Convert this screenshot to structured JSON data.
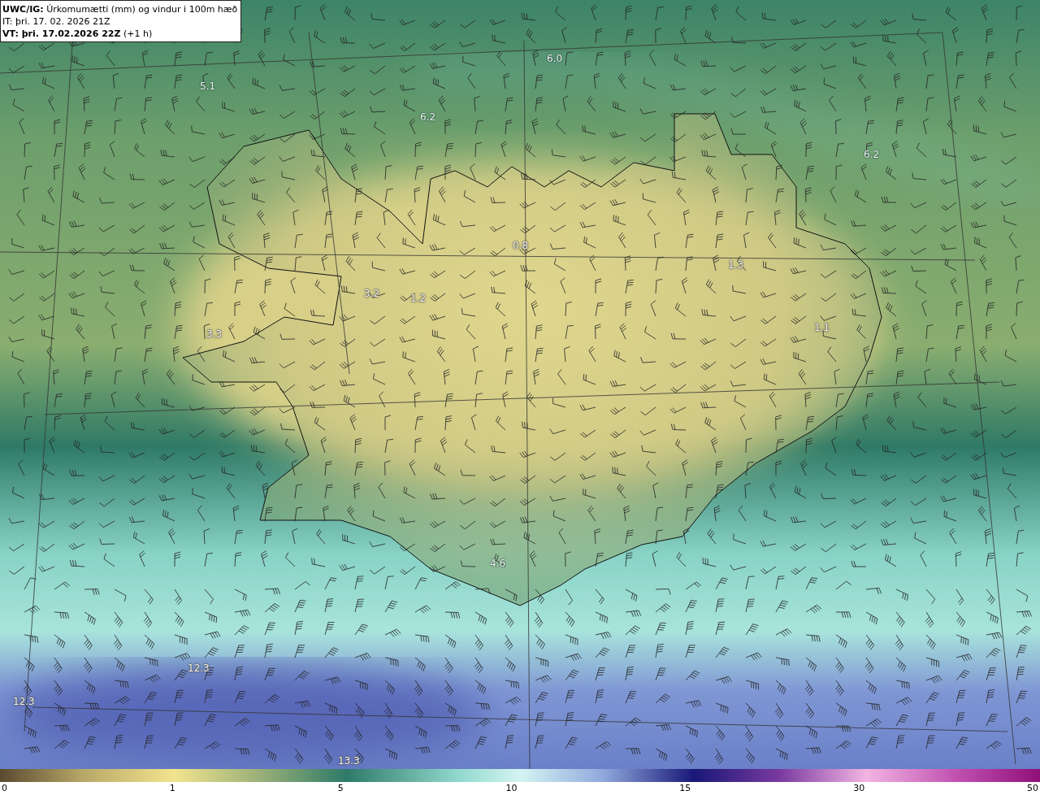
{
  "legend_box": {
    "title": "**UWC/IG:** Úrkomumætti (mm) og vindur i 100m hæð",
    "issue_time": "IT: þri. 17. 02. 2026 21Z",
    "valid_time": "**VT: þri. 17.02.2026 22Z** (+1 h)"
  },
  "map_labels": [
    {
      "text": "5.1",
      "kind": "normal"
    },
    {
      "text": "6.0",
      "kind": "normal"
    },
    {
      "text": "6.2",
      "kind": "normal"
    },
    {
      "text": "6.2",
      "kind": "normal"
    },
    {
      "text": "0.8",
      "kind": "faint"
    },
    {
      "text": "1.3",
      "kind": "faint"
    },
    {
      "text": "3.2",
      "kind": "faint"
    },
    {
      "text": "1.2",
      "kind": "faint"
    },
    {
      "text": "1.1",
      "kind": "faint"
    },
    {
      "text": "3.3",
      "kind": "faint"
    },
    {
      "text": "4.6",
      "kind": "normal"
    },
    {
      "text": "12.3",
      "kind": "faint"
    },
    {
      "text": "12.3",
      "kind": "faint"
    },
    {
      "text": "13.3",
      "kind": "faint"
    }
  ],
  "colorbar": {
    "ticks": [
      "0",
      "1",
      "5",
      "10",
      "15",
      "30",
      "50"
    ]
  }
}
